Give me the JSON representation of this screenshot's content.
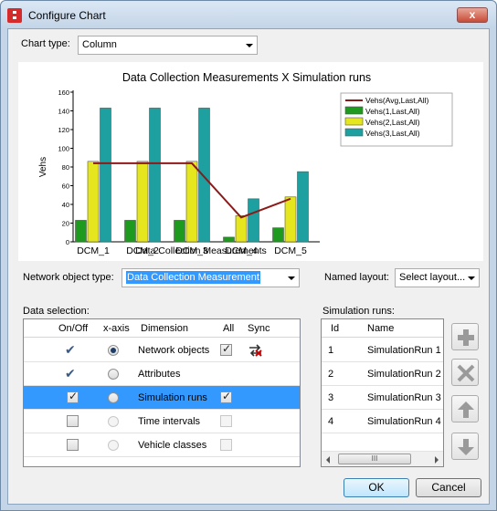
{
  "window": {
    "title": "Configure Chart",
    "close_glyph": "x"
  },
  "chart_type": {
    "label": "Chart type:",
    "value": "Column"
  },
  "chart_data": {
    "type": "bar",
    "title": "Data Collection Measurements  X Simulation runs",
    "xlabel": "Data Collection Measurements",
    "ylabel": "Vehs",
    "ylim": [
      0,
      160
    ],
    "yticks": [
      "0",
      "20",
      "40",
      "60",
      "80",
      "100",
      "120",
      "140",
      "160"
    ],
    "categories": [
      "DCM_1",
      "DCM_2",
      "DCM_3",
      "DCM_4",
      "DCM_5"
    ],
    "series": [
      {
        "name": "Vehs(1,Last,All)",
        "color": "#1e9a1e",
        "values": [
          23,
          23,
          23,
          5,
          15
        ]
      },
      {
        "name": "Vehs(2,Last,All)",
        "color": "#e6e61e",
        "values": [
          86,
          86,
          86,
          28,
          48
        ]
      },
      {
        "name": "Vehs(3,Last,All)",
        "color": "#1fa0a0",
        "values": [
          143,
          143,
          143,
          46,
          75
        ]
      }
    ],
    "line_series": {
      "name": "Vehs(Avg,Last,All)",
      "color": "#8b1a1a",
      "values": [
        84,
        84,
        84,
        26,
        46
      ]
    },
    "grid": false,
    "legend": "top-right"
  },
  "network_object_type": {
    "label": "Network object type:",
    "value": "Data Collection Measurement"
  },
  "named_layout": {
    "label": "Named layout:",
    "value": "Select layout..."
  },
  "data_selection": {
    "label": "Data selection:",
    "columns": [
      "On/Off",
      "x-axis",
      "Dimension",
      "All",
      "Sync"
    ],
    "rows": [
      {
        "dimension": "Network objects",
        "onoff": "tick",
        "xaxis": "on",
        "all": "checked",
        "sync": "sync-off-icon",
        "selected": false
      },
      {
        "dimension": "Attributes",
        "onoff": "tick",
        "xaxis": "off",
        "all": "none",
        "sync": "",
        "selected": false
      },
      {
        "dimension": "Simulation runs",
        "onoff": "checked",
        "xaxis": "off",
        "all": "checked",
        "sync": "",
        "selected": true
      },
      {
        "dimension": "Time intervals",
        "onoff": "unchecked",
        "xaxis": "disabled",
        "all": "disabled",
        "sync": "",
        "selected": false
      },
      {
        "dimension": "Vehicle classes",
        "onoff": "unchecked",
        "xaxis": "disabled",
        "all": "disabled",
        "sync": "",
        "selected": false
      }
    ]
  },
  "simulation_runs": {
    "label": "Simulation runs:",
    "columns": [
      "Id",
      "Name"
    ],
    "rows": [
      {
        "id": "1",
        "name": "SimulationRun 1"
      },
      {
        "id": "2",
        "name": "SimulationRun 2"
      },
      {
        "id": "3",
        "name": "SimulationRun 3"
      },
      {
        "id": "4",
        "name": "SimulationRun 4"
      }
    ],
    "scroll_grip": "III"
  },
  "side_buttons": [
    "add-icon",
    "delete-icon",
    "move-up-icon",
    "move-down-icon"
  ],
  "buttons": {
    "ok": "OK",
    "cancel": "Cancel"
  }
}
